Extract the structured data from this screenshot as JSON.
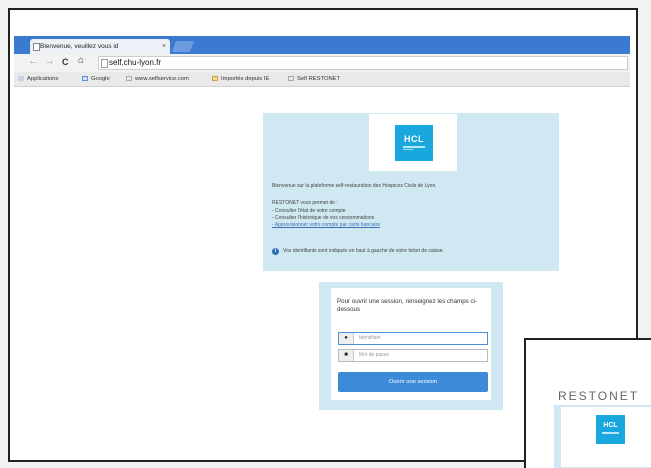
{
  "browser": {
    "tab_title": "Bienvenue, veuillez vous id",
    "tab_close": "×",
    "url": "self.chu-lyon.fr",
    "nav": {
      "back": "←",
      "forward": "→",
      "reload": "C",
      "home": "⌂"
    },
    "bookmarks": [
      "Applications",
      "Google",
      "www.selfservice.com",
      "Importés depuis IE",
      "Self RESTONET"
    ]
  },
  "info_panel": {
    "logo_text": "HCL",
    "welcome": "Bienvenue sur la plateforme self-restauration des Hospices Civils de Lyon.",
    "intro": "RESTONET vous permet de :",
    "bullets": [
      "- Consulter l'état de votre compte",
      "- Consulter l'historique de vos consommations"
    ],
    "link_bullet": "- Approvisionner votre compte par carte bancaire",
    "note": "Vos identifiants sont indiqués en haut à gauche de votre ticket de caisse."
  },
  "login": {
    "prompt": "Pour ouvrir une session, renseignez les champs ci-dessous",
    "username_placeholder": "Identifiant",
    "password_placeholder": "Mot de passe",
    "connect_label": "Ouvrir une session"
  },
  "inset": {
    "title": "RESTONET",
    "logo_text": "HCL"
  },
  "colors": {
    "accent": "#3c8bd8",
    "panel": "#cfe8f2",
    "logo": "#19a7de",
    "tabbar": "#3a7ad0"
  },
  "icons": [
    "page-icon",
    "close-icon",
    "back-arrow-icon",
    "forward-arrow-icon",
    "reload-icon",
    "home-icon",
    "apps-icon",
    "folder-icon",
    "info-icon",
    "user-icon",
    "lock-icon"
  ]
}
